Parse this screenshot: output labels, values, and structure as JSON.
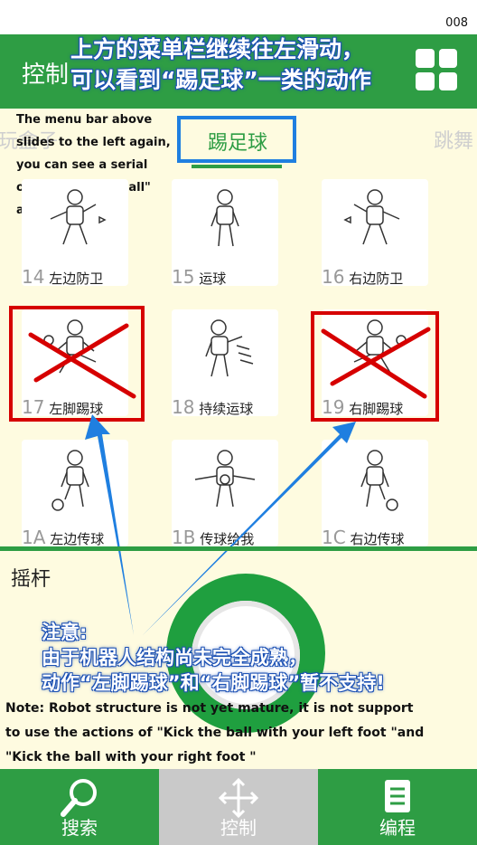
{
  "page_number": "008",
  "header": {
    "title": "控制"
  },
  "caption_cn": [
    "上方的菜单栏继续往左滑动，",
    "可以看到“踢足球”一类的动作"
  ],
  "note_en_top": "The menu bar above slides to the left again, you can see a serial of\"play the football\" actions.",
  "tabs": [
    {
      "label": "玩盒子",
      "state": "partial"
    },
    {
      "label": "踢足球",
      "state": "active"
    },
    {
      "label": "跳舞",
      "state": "partial"
    }
  ],
  "actions": [
    {
      "num": "14",
      "name": "左边防卫"
    },
    {
      "num": "15",
      "name": "运球"
    },
    {
      "num": "16",
      "name": "右边防卫"
    },
    {
      "num": "17",
      "name": "左脚踢球",
      "crossed": true
    },
    {
      "num": "18",
      "name": "持续运球"
    },
    {
      "num": "19",
      "name": "右脚踢球",
      "crossed": true
    },
    {
      "num": "1A",
      "name": "左边传球"
    },
    {
      "num": "1B",
      "name": "传球给我"
    },
    {
      "num": "1C",
      "name": "右边传球"
    }
  ],
  "joystick": {
    "label": "摇杆"
  },
  "note_cn": [
    "注意:",
    "由于机器人结构尚未完全成熟，",
    "动作“左脚踢球”和“右脚踢球”暂不支持!"
  ],
  "note_en": "Note: Robot structure is not yet mature, it is not support to use the actions of \"Kick the ball with your left foot \"and \"Kick the ball with your right foot \"",
  "bottom_nav": [
    {
      "label": "搜索",
      "icon": "search-icon"
    },
    {
      "label": "控制",
      "icon": "move-icon",
      "active": true
    },
    {
      "label": "编程",
      "icon": "list-icon"
    }
  ],
  "colors": {
    "brand_green": "#2e9d44",
    "highlight_blue": "#1f7fe0",
    "cross_red": "#d60000",
    "panel_bg": "#fefbe0"
  }
}
